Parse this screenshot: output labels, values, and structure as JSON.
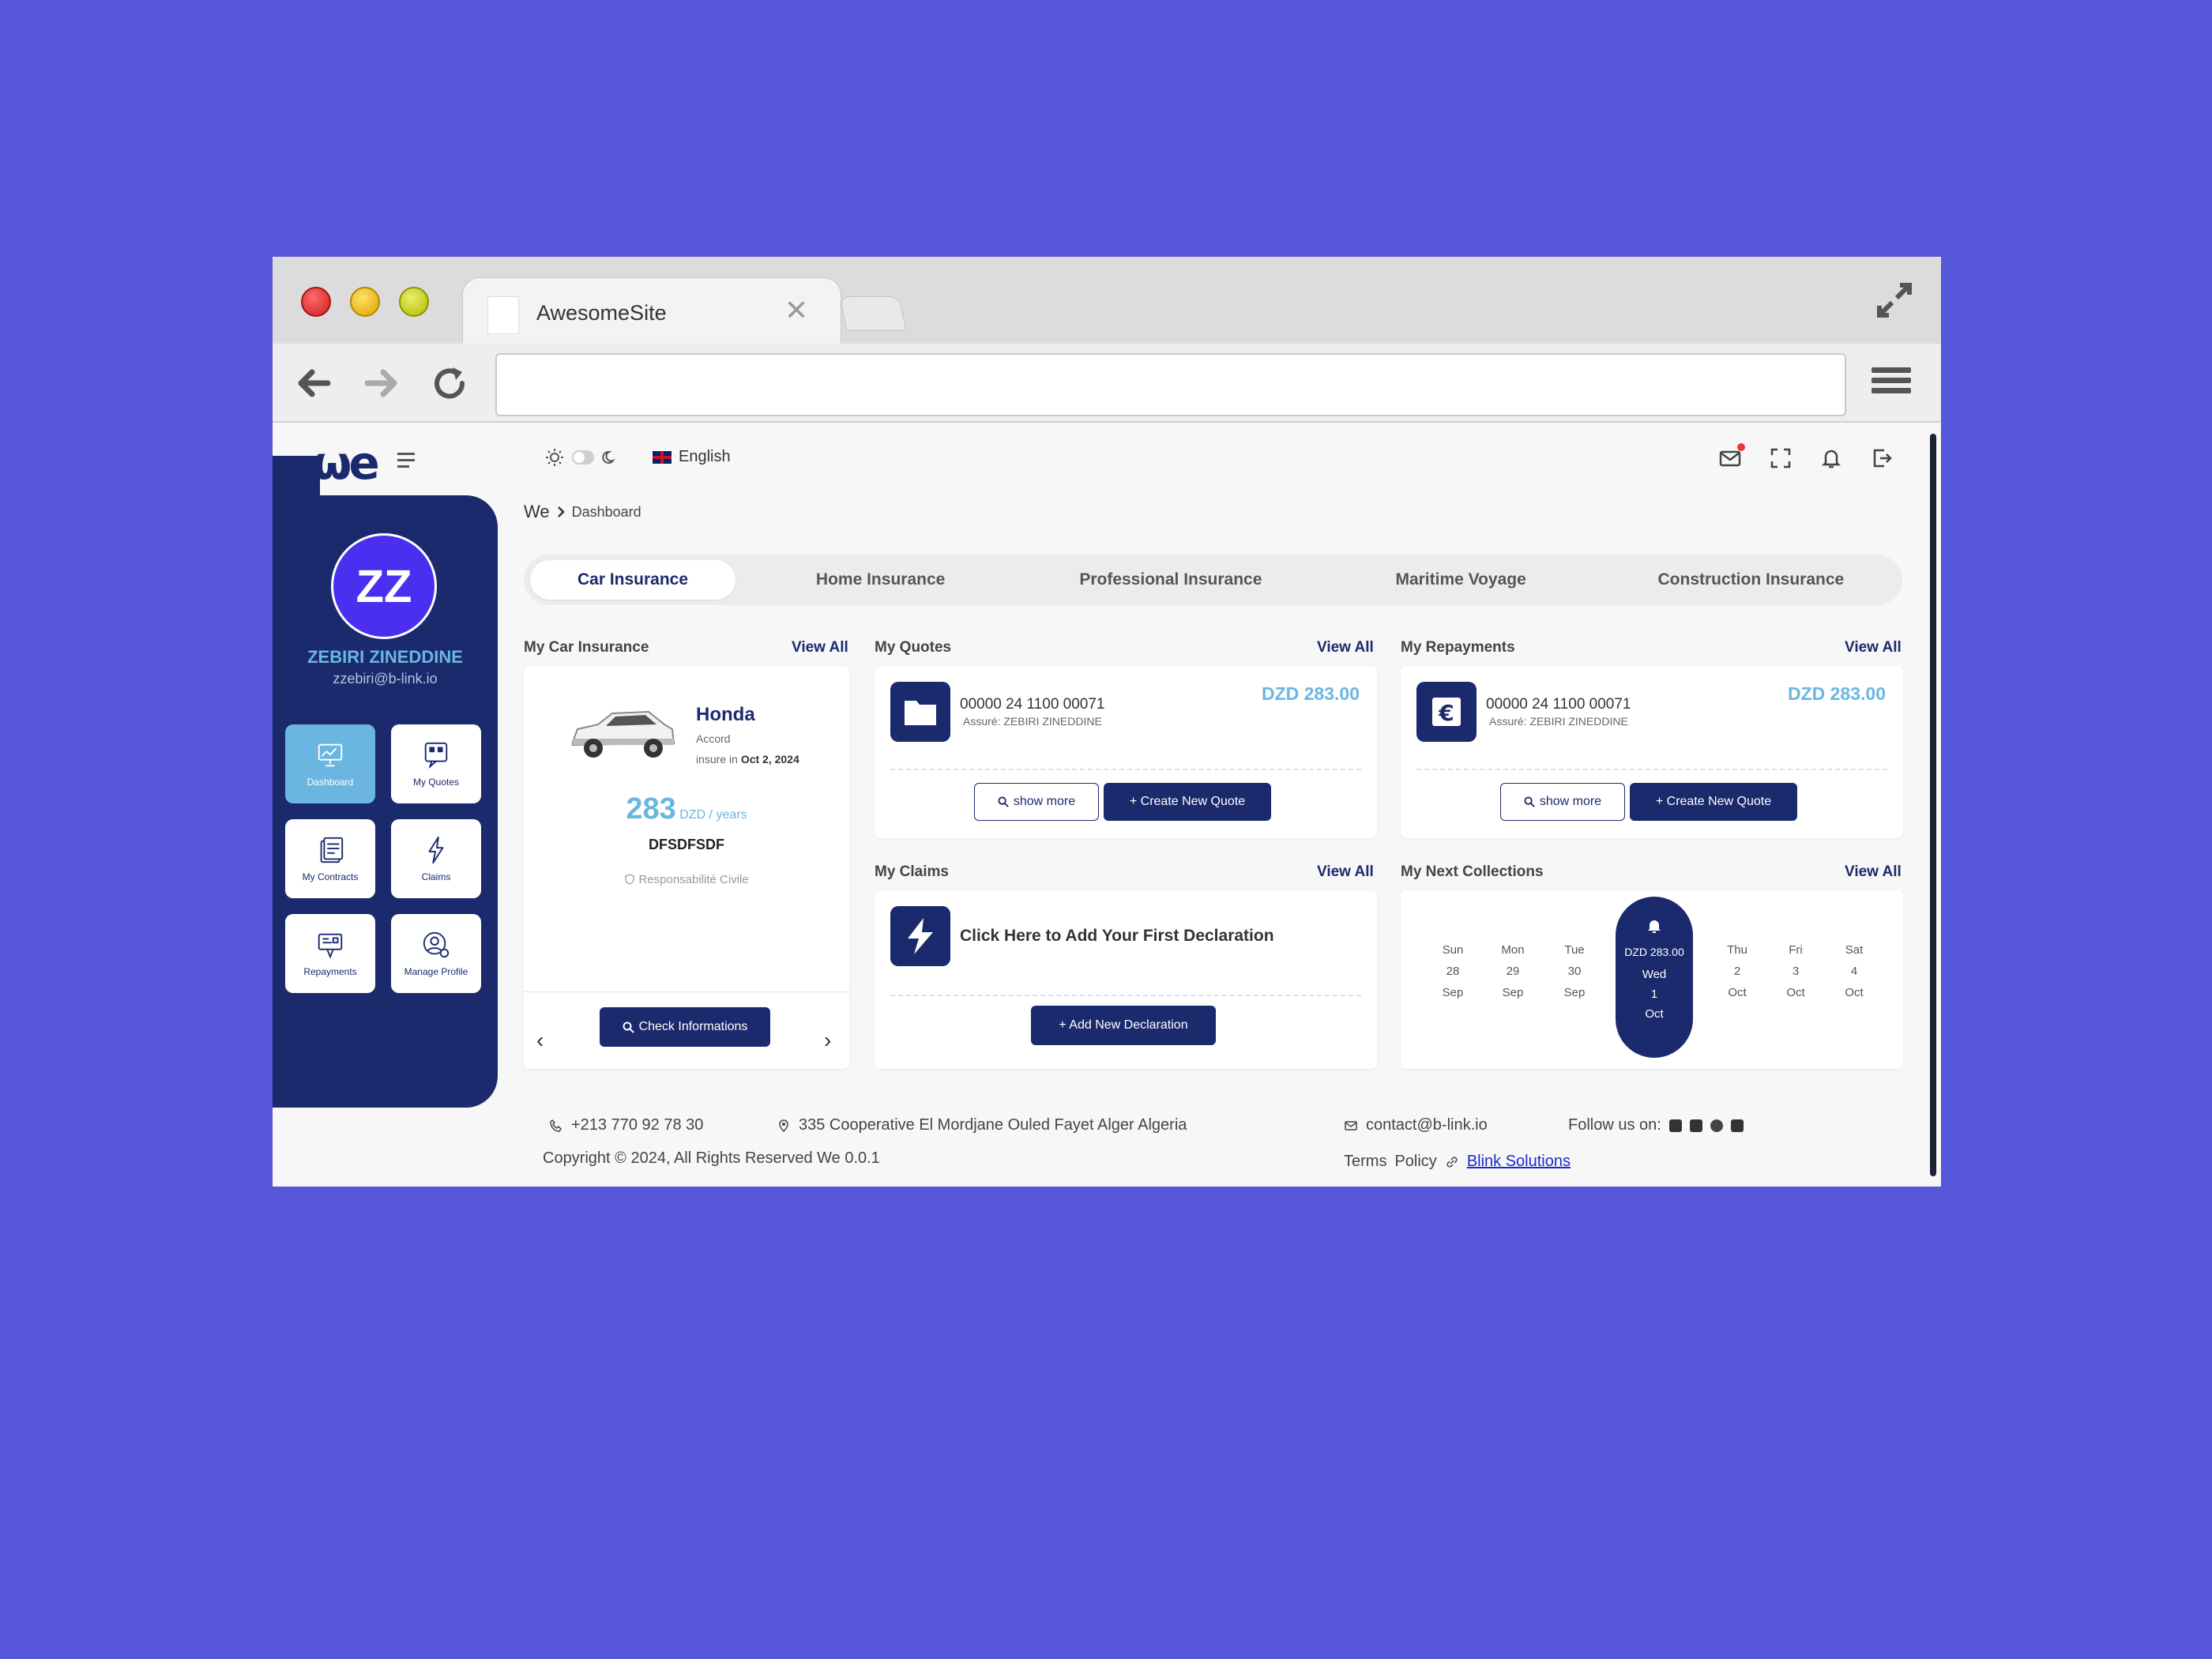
{
  "browser": {
    "tab_title": "AwesomeSite",
    "tab_close": "✕"
  },
  "header": {
    "language": "English"
  },
  "user": {
    "initials": "ZZ",
    "name": "ZEBIRI ZINEDDINE",
    "email": "zzebiri@b-link.io"
  },
  "sidebar": {
    "items": [
      {
        "label": "Dashboard",
        "active": true
      },
      {
        "label": "My Quotes"
      },
      {
        "label": "My Contracts"
      },
      {
        "label": "Claims"
      },
      {
        "label": "Repayments"
      },
      {
        "label": "Manage Profile"
      }
    ]
  },
  "breadcrumb": {
    "root": "We",
    "current": "Dashboard"
  },
  "tabs": [
    "Car Insurance",
    "Home Insurance",
    "Professional Insurance",
    "Maritime Voyage",
    "Construction Insurance"
  ],
  "car": {
    "title": "My Car Insurance",
    "view_all": "View All",
    "brand": "Honda",
    "model": "Accord",
    "insure_prefix": "insure in",
    "insure_date": "Oct 2, 2024",
    "price": "283",
    "unit": "DZD / years",
    "plate": "DFSDFSDF",
    "coverage": "Responsabilité Civile",
    "check_button": "Check Informations",
    "prev": "‹",
    "next": "›"
  },
  "quotes": {
    "title": "My Quotes",
    "view_all": "View All",
    "ref": "00000 24 1100 00071",
    "assure": "Assuré: ZEBIRI ZINEDDINE",
    "amount": "DZD 283.00",
    "show_more": "show more",
    "create": "+ Create New Quote"
  },
  "repayments": {
    "title": "My Repayments",
    "view_all": "View All",
    "ref": "00000 24 1100 00071",
    "assure": "Assuré: ZEBIRI ZINEDDINE",
    "amount": "DZD 283.00",
    "show_more": "show more",
    "create": "+ Create New Quote"
  },
  "claims": {
    "title": "My Claims",
    "view_all": "View All",
    "prompt": "Click Here to Add Your First Declaration",
    "add": "+ Add New Declaration"
  },
  "collections": {
    "title": "My Next Collections",
    "view_all": "View All",
    "days": [
      {
        "dow": "Sun",
        "day": "28",
        "mon": "Sep"
      },
      {
        "dow": "Mon",
        "day": "29",
        "mon": "Sep"
      },
      {
        "dow": "Tue",
        "day": "30",
        "mon": "Sep"
      },
      {
        "dow": "Thu",
        "day": "2",
        "mon": "Oct"
      },
      {
        "dow": "Fri",
        "day": "3",
        "mon": "Oct"
      },
      {
        "dow": "Sat",
        "day": "4",
        "mon": "Oct"
      }
    ],
    "active": {
      "amount": "DZD 283.00",
      "dow": "Wed",
      "day": "1",
      "mon": "Oct"
    }
  },
  "footer": {
    "phone": "+213 770 92 78 30",
    "address": "335 Cooperative El Mordjane Ouled Fayet Alger Algeria",
    "email": "contact@b-link.io",
    "follow": "Follow us on:",
    "copyright": "Copyright © 2024, All Rights Reserved We 0.0.1",
    "terms": "Terms",
    "policy": "Policy",
    "company": "Blink Solutions"
  },
  "colors": {
    "primary": "#1a2a6c",
    "accent": "#6bb6e0",
    "avatar": "#4a2ff0",
    "background": "#5757d9"
  }
}
